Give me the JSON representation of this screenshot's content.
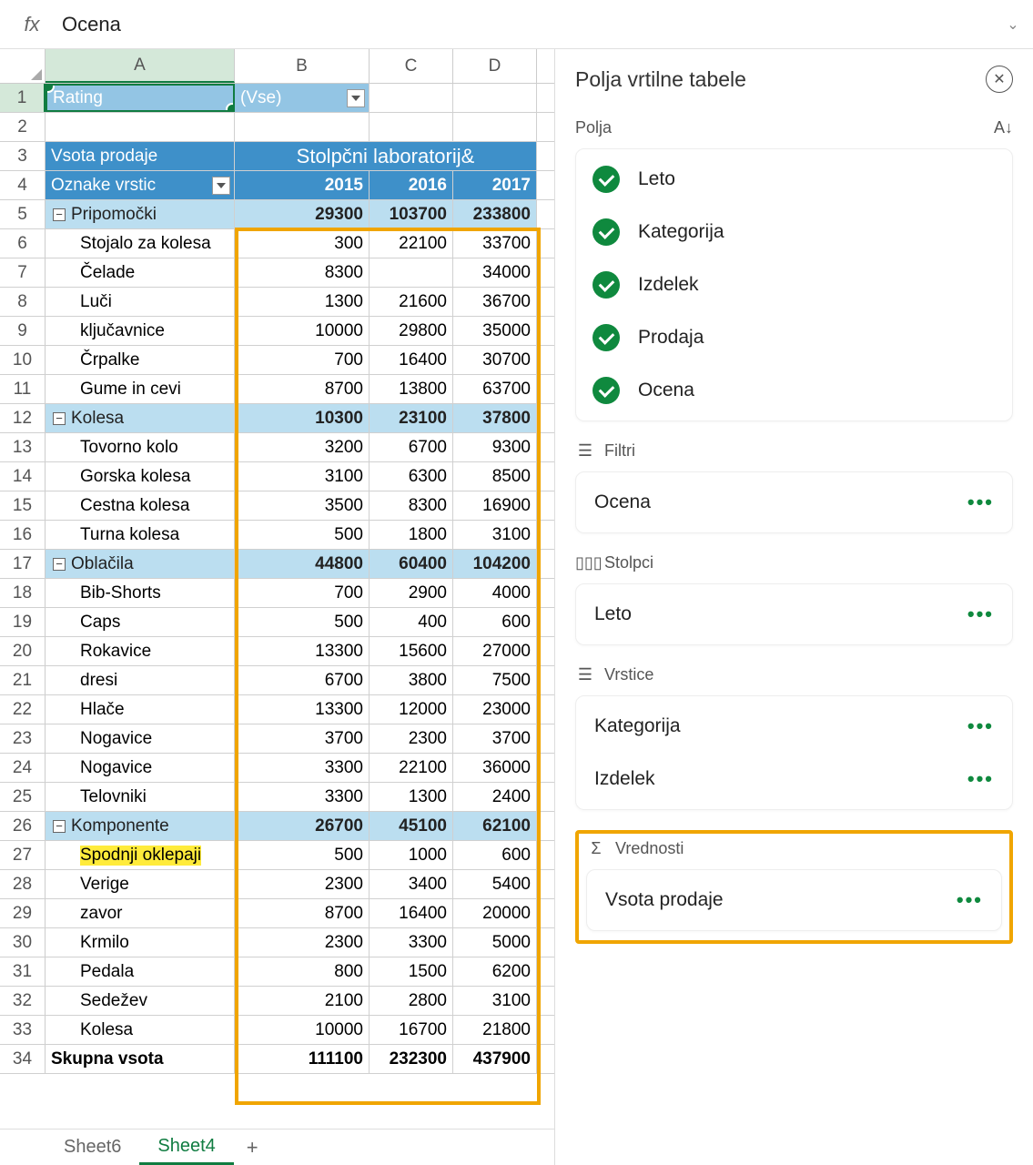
{
  "formula": "Ocena",
  "cols": [
    "A",
    "B",
    "C",
    "D"
  ],
  "pivot": {
    "a1": "Rating",
    "b1": "(Vse)",
    "a3": "Vsota prodaje",
    "bcd3": "Stolpčni laboratorij&amp;",
    "a4": "Oznake vrstic",
    "y": [
      "2015",
      "2016",
      "2017"
    ],
    "a34": "Skupna vsota",
    "t": [
      "111100",
      "232300",
      "437900"
    ]
  },
  "rows": [
    {
      "n": 5,
      "lab": "Pripomočki",
      "t": "g",
      "v": [
        "29300",
        "103700",
        "233800"
      ]
    },
    {
      "n": 6,
      "lab": "Stojalo za kolesa",
      "t": "c",
      "v": [
        "300",
        "22100",
        "33700"
      ]
    },
    {
      "n": 7,
      "lab": "Čelade",
      "t": "c",
      "v": [
        "8300",
        "",
        "34000"
      ]
    },
    {
      "n": 8,
      "lab": "Luči",
      "t": "c",
      "v": [
        "1300",
        "21600",
        "36700"
      ]
    },
    {
      "n": 9,
      "lab": "ključavnice",
      "t": "c",
      "v": [
        "10000",
        "29800",
        "35000"
      ]
    },
    {
      "n": 10,
      "lab": "Črpalke",
      "t": "c",
      "v": [
        "700",
        "16400",
        "30700"
      ]
    },
    {
      "n": 11,
      "lab": "Gume in cevi",
      "t": "c",
      "v": [
        "8700",
        "13800",
        "63700"
      ]
    },
    {
      "n": 12,
      "lab": "Kolesa",
      "t": "g",
      "v": [
        "10300",
        "23100",
        "37800"
      ]
    },
    {
      "n": 13,
      "lab": "Tovorno kolo",
      "t": "c",
      "v": [
        "3200",
        "6700",
        "9300"
      ]
    },
    {
      "n": 14,
      "lab": "Gorska kolesa",
      "t": "c",
      "v": [
        "3100",
        "6300",
        "8500"
      ]
    },
    {
      "n": 15,
      "lab": "Cestna kolesa",
      "t": "c",
      "v": [
        "3500",
        "8300",
        "16900"
      ]
    },
    {
      "n": 16,
      "lab": "Turna kolesa",
      "t": "c",
      "v": [
        "500",
        "1800",
        "3100"
      ]
    },
    {
      "n": 17,
      "lab": "Oblačila",
      "t": "g",
      "v": [
        "44800",
        "60400",
        "104200"
      ]
    },
    {
      "n": 18,
      "lab": "Bib-Shorts",
      "t": "c",
      "v": [
        "700",
        "2900",
        "4000"
      ]
    },
    {
      "n": 19,
      "lab": "Caps",
      "t": "c",
      "v": [
        "500",
        "400",
        "600"
      ]
    },
    {
      "n": 20,
      "lab": "Rokavice",
      "t": "c",
      "v": [
        "13300",
        "15600",
        "27000"
      ]
    },
    {
      "n": 21,
      "lab": "dresi",
      "t": "c",
      "v": [
        "6700",
        "3800",
        "7500"
      ]
    },
    {
      "n": 22,
      "lab": "Hlače",
      "t": "c",
      "v": [
        "13300",
        "12000",
        "23000"
      ]
    },
    {
      "n": 23,
      "lab": "Nogavice",
      "t": "c",
      "v": [
        "3700",
        "2300",
        "3700"
      ]
    },
    {
      "n": 24,
      "lab": "Nogavice",
      "t": "c",
      "v": [
        "3300",
        "22100",
        "36000"
      ]
    },
    {
      "n": 25,
      "lab": "Telovniki",
      "t": "c",
      "v": [
        "3300",
        "1300",
        "2400"
      ]
    },
    {
      "n": 26,
      "lab": "Komponente",
      "t": "g",
      "v": [
        "26700",
        "45100",
        "62100"
      ]
    },
    {
      "n": 27,
      "lab": "Spodnji oklepaji",
      "t": "c",
      "v": [
        "500",
        "1000",
        "600"
      ],
      "hl": true
    },
    {
      "n": 28,
      "lab": "Verige",
      "t": "c",
      "v": [
        "2300",
        "3400",
        "5400"
      ]
    },
    {
      "n": 29,
      "lab": "zavor",
      "t": "c",
      "v": [
        "8700",
        "16400",
        "20000"
      ]
    },
    {
      "n": 30,
      "lab": "Krmilo",
      "t": "c",
      "v": [
        "2300",
        "3300",
        "5000"
      ]
    },
    {
      "n": 31,
      "lab": "Pedala",
      "t": "c",
      "v": [
        "800",
        "1500",
        "6200"
      ]
    },
    {
      "n": 32,
      "lab": "Sedežev",
      "t": "c",
      "v": [
        "2100",
        "2800",
        "3100"
      ]
    },
    {
      "n": 33,
      "lab": "Kolesa",
      "t": "c",
      "v": [
        "10000",
        "16700",
        "21800"
      ]
    }
  ],
  "pane": {
    "title": "Polja vrtilne tabele",
    "fieldsLabel": "Polja",
    "fields": [
      "Leto",
      "Kategorija",
      "Izdelek",
      "Prodaja",
      "Ocena"
    ],
    "filters": {
      "lab": "Filtri",
      "items": [
        "Ocena"
      ]
    },
    "columns": {
      "lab": "Stolpci",
      "items": [
        "Leto"
      ]
    },
    "rowsz": {
      "lab": "Vrstice",
      "items": [
        "Kategorija",
        "Izdelek"
      ]
    },
    "values": {
      "lab": "Vrednosti",
      "items": [
        "Vsota prodaje"
      ]
    }
  },
  "tabs": {
    "t1": "Sheet6",
    "t2": "Sheet4"
  }
}
